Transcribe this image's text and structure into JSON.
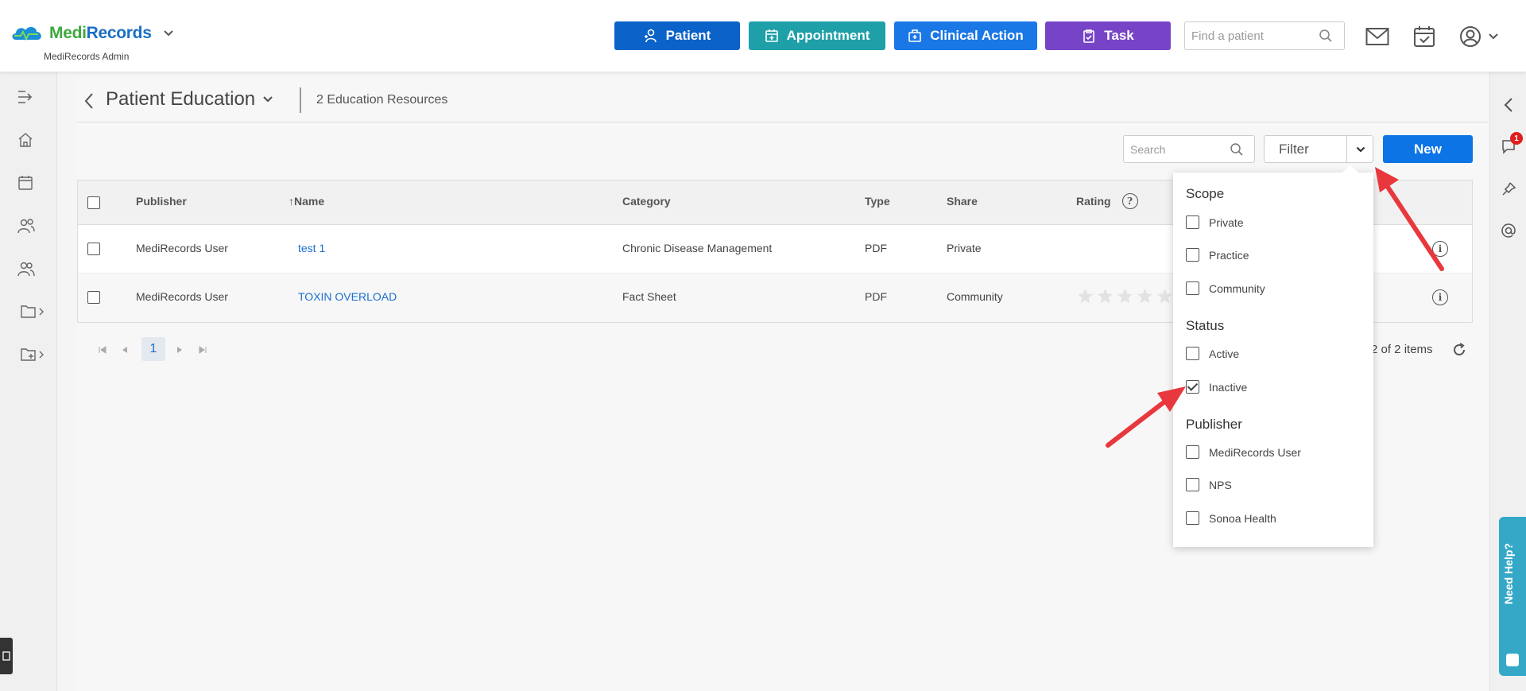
{
  "header": {
    "logo_part1": "Medi",
    "logo_part2": "Records",
    "subtitle": "MediRecords Admin",
    "buttons": {
      "patient": "Patient",
      "appointment": "Appointment",
      "clinical_action": "Clinical Action",
      "task": "Task"
    },
    "find_placeholder": "Find a patient"
  },
  "page": {
    "title": "Patient Education",
    "count_text": "2 Education Resources"
  },
  "toolbar": {
    "search_placeholder": "Search",
    "filter_label": "Filter",
    "new_label": "New"
  },
  "table": {
    "columns": [
      "Publisher",
      "Name",
      "Category",
      "Type",
      "Share",
      "Rating"
    ],
    "rows": [
      {
        "publisher": "MediRecords User",
        "name": "test 1",
        "category": "Chronic Disease Management",
        "type": "PDF",
        "share": "Private"
      },
      {
        "publisher": "MediRecords User",
        "name": "TOXIN OVERLOAD",
        "category": "Fact Sheet",
        "type": "PDF",
        "share": "Community",
        "rating": 0
      }
    ]
  },
  "pager": {
    "current_page": "1",
    "items_text": "2 of 2 items"
  },
  "filter_menu": {
    "scope_title": "Scope",
    "scope_options": [
      {
        "label": "Private",
        "checked": false
      },
      {
        "label": "Practice",
        "checked": false
      },
      {
        "label": "Community",
        "checked": false
      }
    ],
    "status_title": "Status",
    "status_options": [
      {
        "label": "Active",
        "checked": false
      },
      {
        "label": "Inactive",
        "checked": true
      }
    ],
    "publisher_title": "Publisher",
    "publisher_options": [
      {
        "label": "MediRecords User",
        "checked": false
      },
      {
        "label": "NPS",
        "checked": false
      },
      {
        "label": "Sonoa Health",
        "checked": false
      }
    ]
  },
  "right_rail": {
    "notification_count": "1",
    "need_help": "Need Help?"
  },
  "colors": {
    "patient_button": "#0b62c9",
    "appointment_button": "#1fa0a8",
    "clinical_action_button": "#1a77e6",
    "task_button": "#7744c8",
    "new_button": "#0d74e6",
    "link": "#1a6fd1",
    "annotation_arrow": "#e8383d"
  }
}
